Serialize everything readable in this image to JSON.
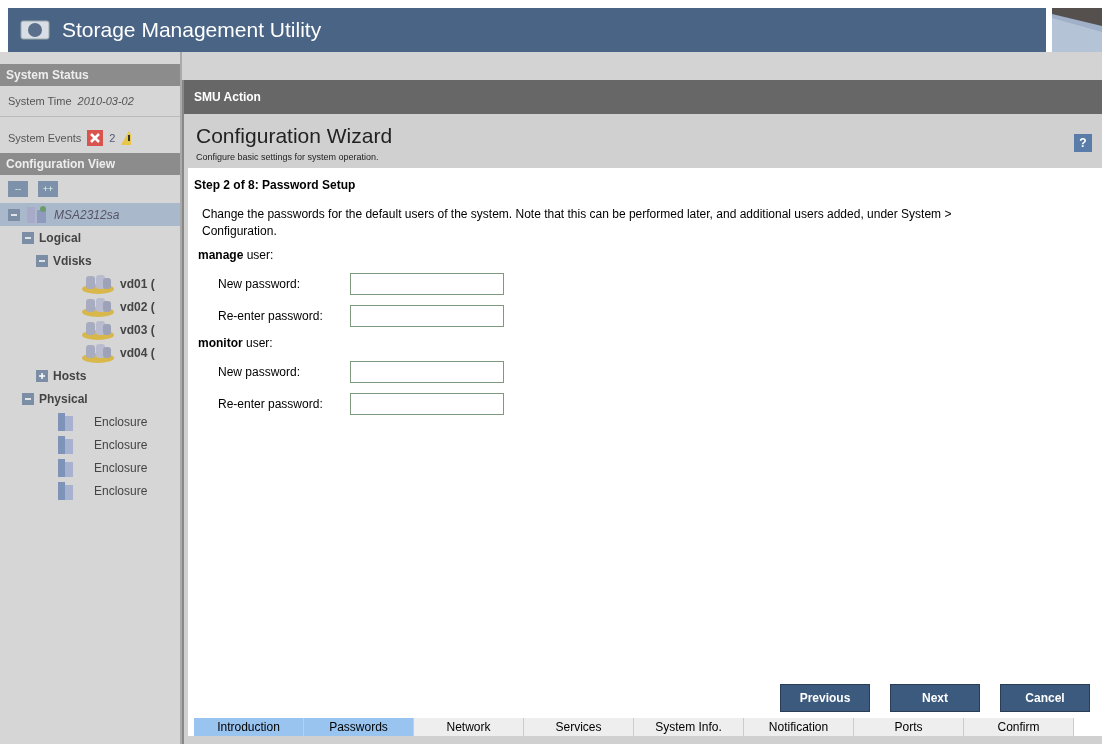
{
  "app": {
    "title": "Storage Management Utility"
  },
  "system_status": {
    "heading": "System Status",
    "time_label": "System Time",
    "time_value": "2010-03-02",
    "events_label": "System Events",
    "error_count": "2"
  },
  "configuration_view": {
    "heading": "Configuration View",
    "collapse_all": "--",
    "expand_all": "++",
    "tree": [
      {
        "label": "MSA2312sa",
        "kind": "system",
        "expanded": true,
        "selected": true,
        "children": [
          {
            "label": "Logical",
            "kind": "folder",
            "expanded": true,
            "selected": false,
            "children": [
              {
                "label": "Vdisks",
                "kind": "folder",
                "expanded": true,
                "selected": false,
                "children": [
                  {
                    "label": "vd01 (",
                    "kind": "vdisk",
                    "selected": false
                  },
                  {
                    "label": "vd02 (",
                    "kind": "vdisk",
                    "selected": false
                  },
                  {
                    "label": "vd03 (",
                    "kind": "vdisk",
                    "selected": false
                  },
                  {
                    "label": "vd04 (",
                    "kind": "vdisk",
                    "selected": false
                  }
                ]
              },
              {
                "label": "Hosts",
                "kind": "folder",
                "expanded": false,
                "selected": false
              }
            ]
          },
          {
            "label": "Physical",
            "kind": "folder",
            "expanded": true,
            "selected": false,
            "children": [
              {
                "label": "Enclosure",
                "kind": "enclosure",
                "selected": false
              },
              {
                "label": "Enclosure",
                "kind": "enclosure",
                "selected": false
              },
              {
                "label": "Enclosure",
                "kind": "enclosure",
                "selected": false
              },
              {
                "label": "Enclosure",
                "kind": "enclosure",
                "selected": false
              }
            ]
          }
        ]
      }
    ]
  },
  "dialog": {
    "title": "SMU Action",
    "heading": "Configuration Wizard",
    "subtitle": "Configure basic settings for system operation.",
    "help": "?",
    "step": "Step 2 of 8: Password Setup",
    "description": "Change the passwords for the default users of the system. Note that this can be performed later, and additional users added, under System > Configuration.",
    "user_groups": [
      {
        "title": "**manage** user:",
        "fields": [
          {
            "label": "New password:"
          },
          {
            "label": "Re-enter password:"
          }
        ]
      },
      {
        "title": "**monitor** user:",
        "fields": [
          {
            "label": "New password:"
          },
          {
            "label": "Re-enter password:"
          }
        ]
      }
    ],
    "buttons": [
      "Previous",
      "Next",
      "Cancel"
    ],
    "steps": [
      {
        "label": "Introduction",
        "active": true
      },
      {
        "label": "Passwords",
        "active": true
      },
      {
        "label": "Network",
        "active": false
      },
      {
        "label": "Services",
        "active": false
      },
      {
        "label": "System Info.",
        "active": false
      },
      {
        "label": "Notification",
        "active": false
      },
      {
        "label": "Ports",
        "active": false
      },
      {
        "label": "Confirm",
        "active": false
      }
    ]
  }
}
